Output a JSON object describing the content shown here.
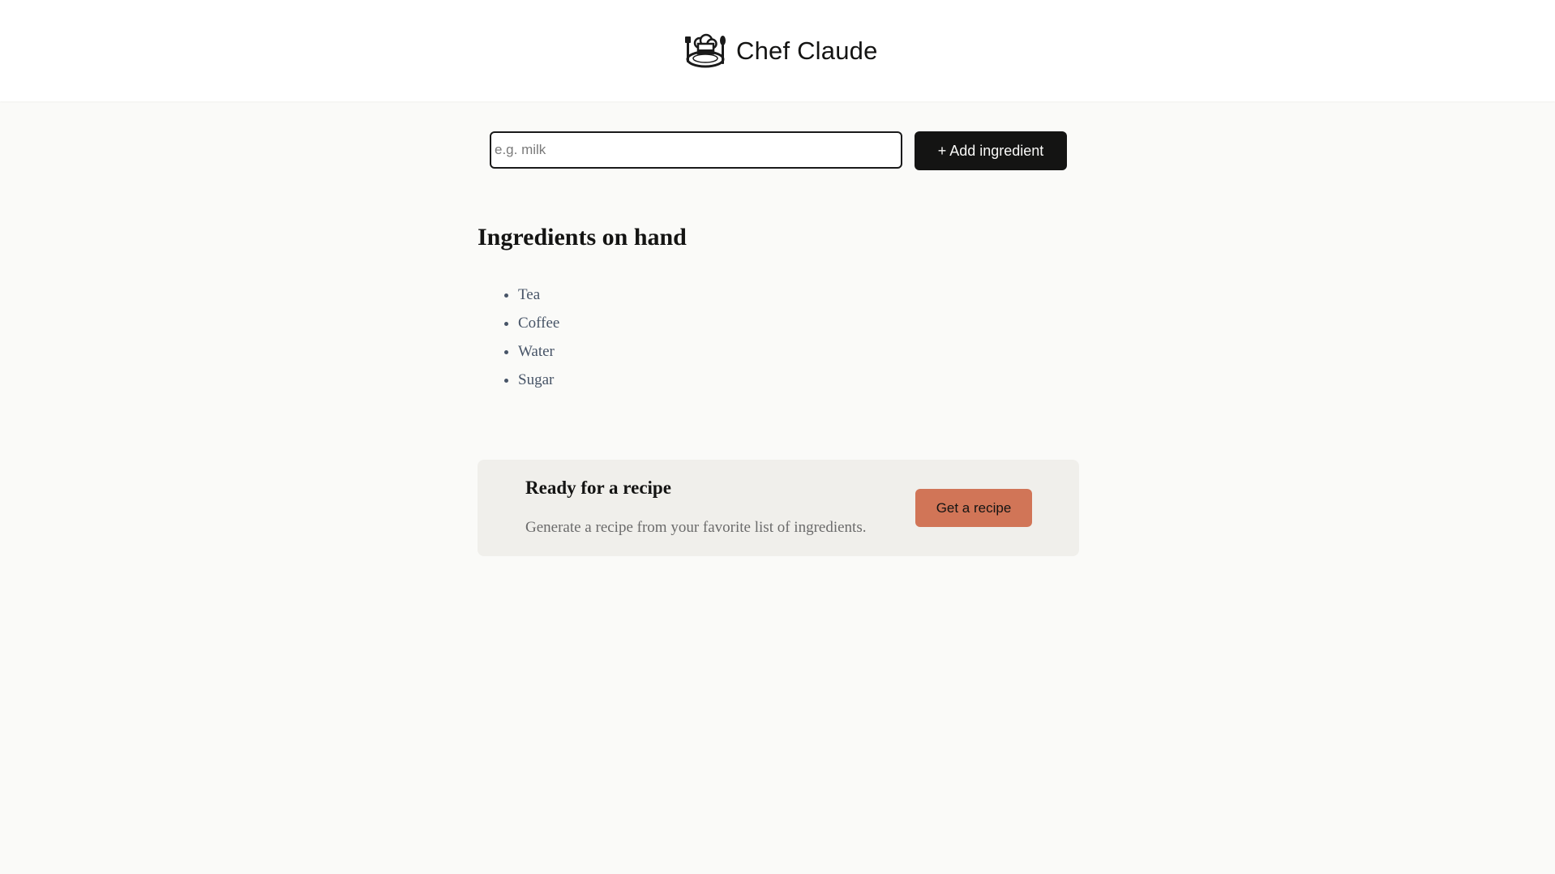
{
  "header": {
    "title": "Chef Claude",
    "logo_icon": "chef-hat-icon"
  },
  "form": {
    "input_value": "",
    "input_placeholder": "e.g. milk",
    "add_button_label": "+ Add ingredient"
  },
  "ingredients": {
    "title": "Ingredients on hand",
    "items": [
      "Tea",
      "Coffee",
      "Water",
      "Sugar"
    ]
  },
  "recipe_card": {
    "title": "Ready for a recipe",
    "description": "Generate a recipe from your favorite list of ingredients.",
    "button_label": "Get a recipe"
  },
  "colors": {
    "page_background": "#fafaf8",
    "header_background": "#ffffff",
    "primary_button": "#141413",
    "accent_button": "#d17557",
    "card_background": "#f0efeb",
    "list_text": "#475467"
  }
}
